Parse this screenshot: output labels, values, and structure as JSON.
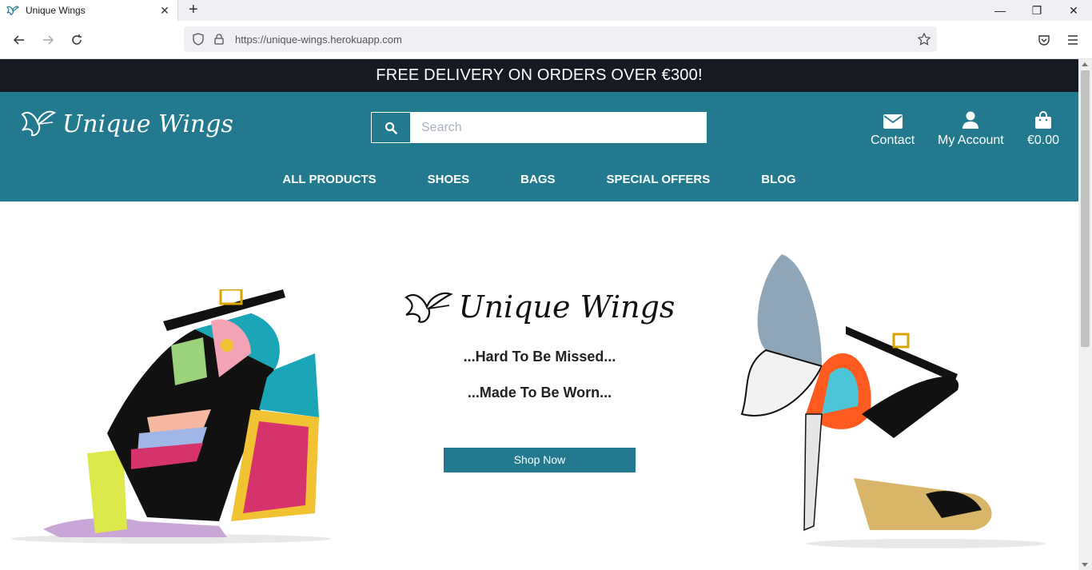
{
  "browser": {
    "tab_title": "Unique Wings",
    "url": "https://unique-wings.herokuapp.com"
  },
  "banner": {
    "text": "FREE DELIVERY ON ORDERS OVER €300!"
  },
  "header": {
    "logo_text": "Unique Wings",
    "search_placeholder": "Search",
    "contact_label": "Contact",
    "account_label": "My Account",
    "cart_total": "€0.00"
  },
  "nav": {
    "items": [
      "ALL PRODUCTS",
      "SHOES",
      "BAGS",
      "SPECIAL OFFERS",
      "BLOG"
    ]
  },
  "hero": {
    "logo_text": "Unique Wings",
    "tagline1": "...Hard To Be Missed...",
    "tagline2": "...Made To Be Worn...",
    "cta_label": "Shop Now"
  },
  "colors": {
    "brand_teal": "#23798d",
    "banner_dark": "#161a22"
  }
}
